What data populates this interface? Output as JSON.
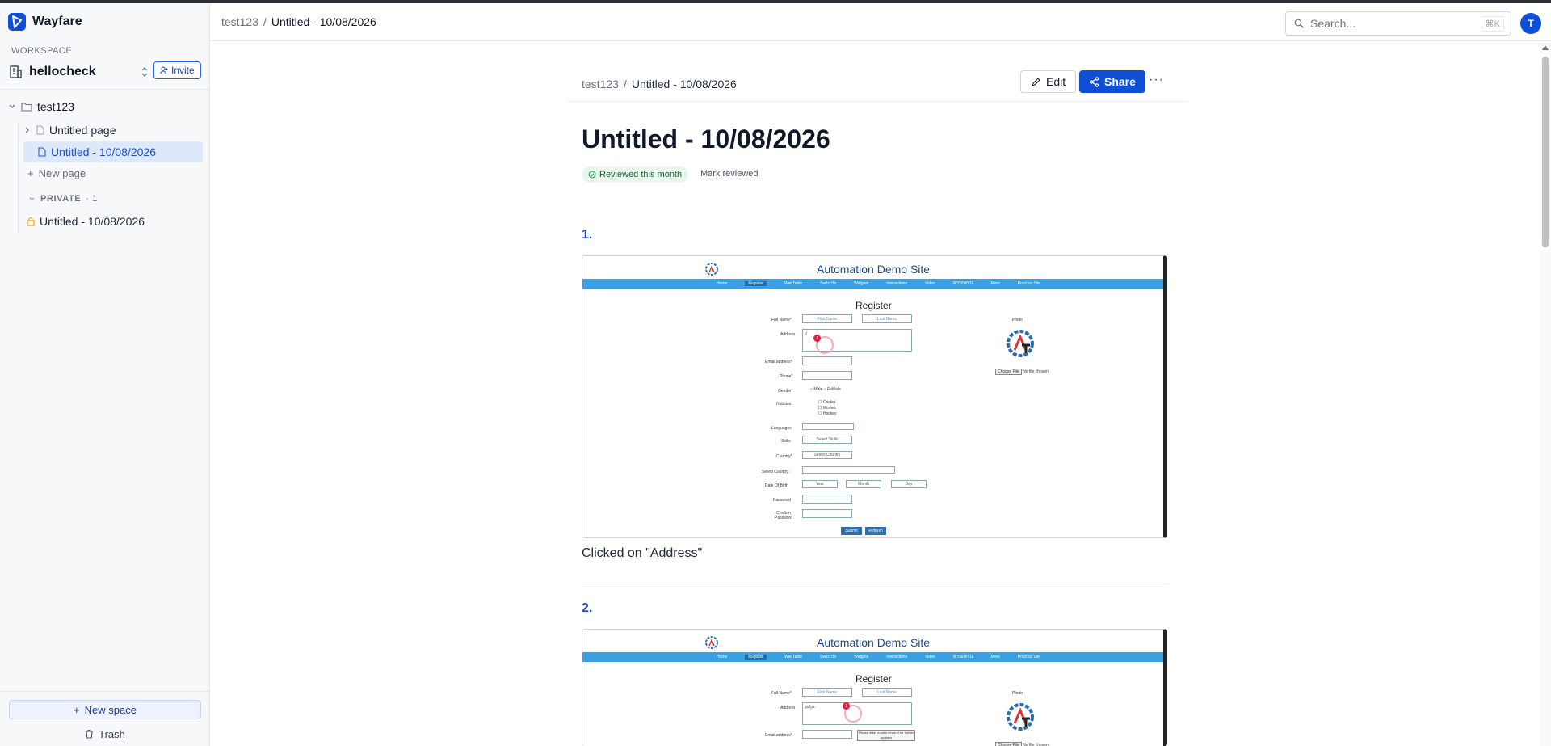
{
  "app": {
    "name": "Wayfare"
  },
  "sidebar": {
    "workspace_label": "WORKSPACE",
    "workspace_name": "hellocheck",
    "invite_label": "Invite",
    "space": {
      "name": "test123"
    },
    "pages": [
      {
        "label": "Untitled page"
      },
      {
        "label": "Untitled - 10/08/2026"
      }
    ],
    "new_page_label": "New page",
    "private": {
      "label": "PRIVATE",
      "count": "· 1",
      "pages": [
        {
          "label": "Untitled - 10/08/2026"
        }
      ]
    },
    "new_space_label": "New space",
    "trash_label": "Trash"
  },
  "topbar": {
    "breadcrumb": [
      "test123",
      "/",
      "Untitled - 10/08/2026"
    ],
    "search_placeholder": "Search...",
    "search_shortcut": "⌘K",
    "avatar_initial": "T"
  },
  "doc": {
    "breadcrumb": [
      "test123",
      "/",
      "Untitled - 10/08/2026"
    ],
    "edit_label": "Edit",
    "share_label": "Share",
    "more_label": "···",
    "title": "Untitled - 10/08/2026",
    "review_badge": "Reviewed this month",
    "mark_reviewed": "Mark reviewed",
    "steps": [
      {
        "number": "1.",
        "caption": "Clicked on \"Address\"",
        "field_value": "g"
      },
      {
        "number": "2.",
        "caption": "",
        "field_value": "gufga"
      }
    ]
  },
  "demo_site": {
    "title": "Automation Demo Site",
    "nav": [
      "Home",
      "Register",
      "WebTable",
      "SwitchTo",
      "Widgets",
      "Interactions",
      "Video",
      "WYSIWYG",
      "More",
      "Practice Site"
    ],
    "register_title": "Register",
    "labels": {
      "full_name": "Full Name*",
      "address": "Address",
      "email": "Email address*",
      "phone": "Phone*",
      "gender": "Gender*",
      "hobbies": "Hobbies",
      "languages": "Languages",
      "skills": "Skills",
      "country": "Country*",
      "select_country": "Select Country :",
      "dob": "Date Of Birth",
      "password": "Password",
      "confirm_password": "Confirm Password"
    },
    "placeholders": {
      "first_name": "First Name",
      "last_name": "Last Name"
    },
    "gender_options": [
      "Male",
      "FeMale"
    ],
    "hobbies_options": [
      "Cricket",
      "Movies",
      "Hockey"
    ],
    "skills_select": "Select Skills",
    "country_select": "Select Country",
    "dob_selects": [
      "Year",
      "Month",
      "Day"
    ],
    "photo_label": "Photo",
    "choose_file": "Choose File",
    "no_file": "No file chosen",
    "submit_label": "Submit",
    "refresh_label": "Refresh",
    "click_marker": "1",
    "tooltip": "Please enter a valid email id for further updates"
  }
}
